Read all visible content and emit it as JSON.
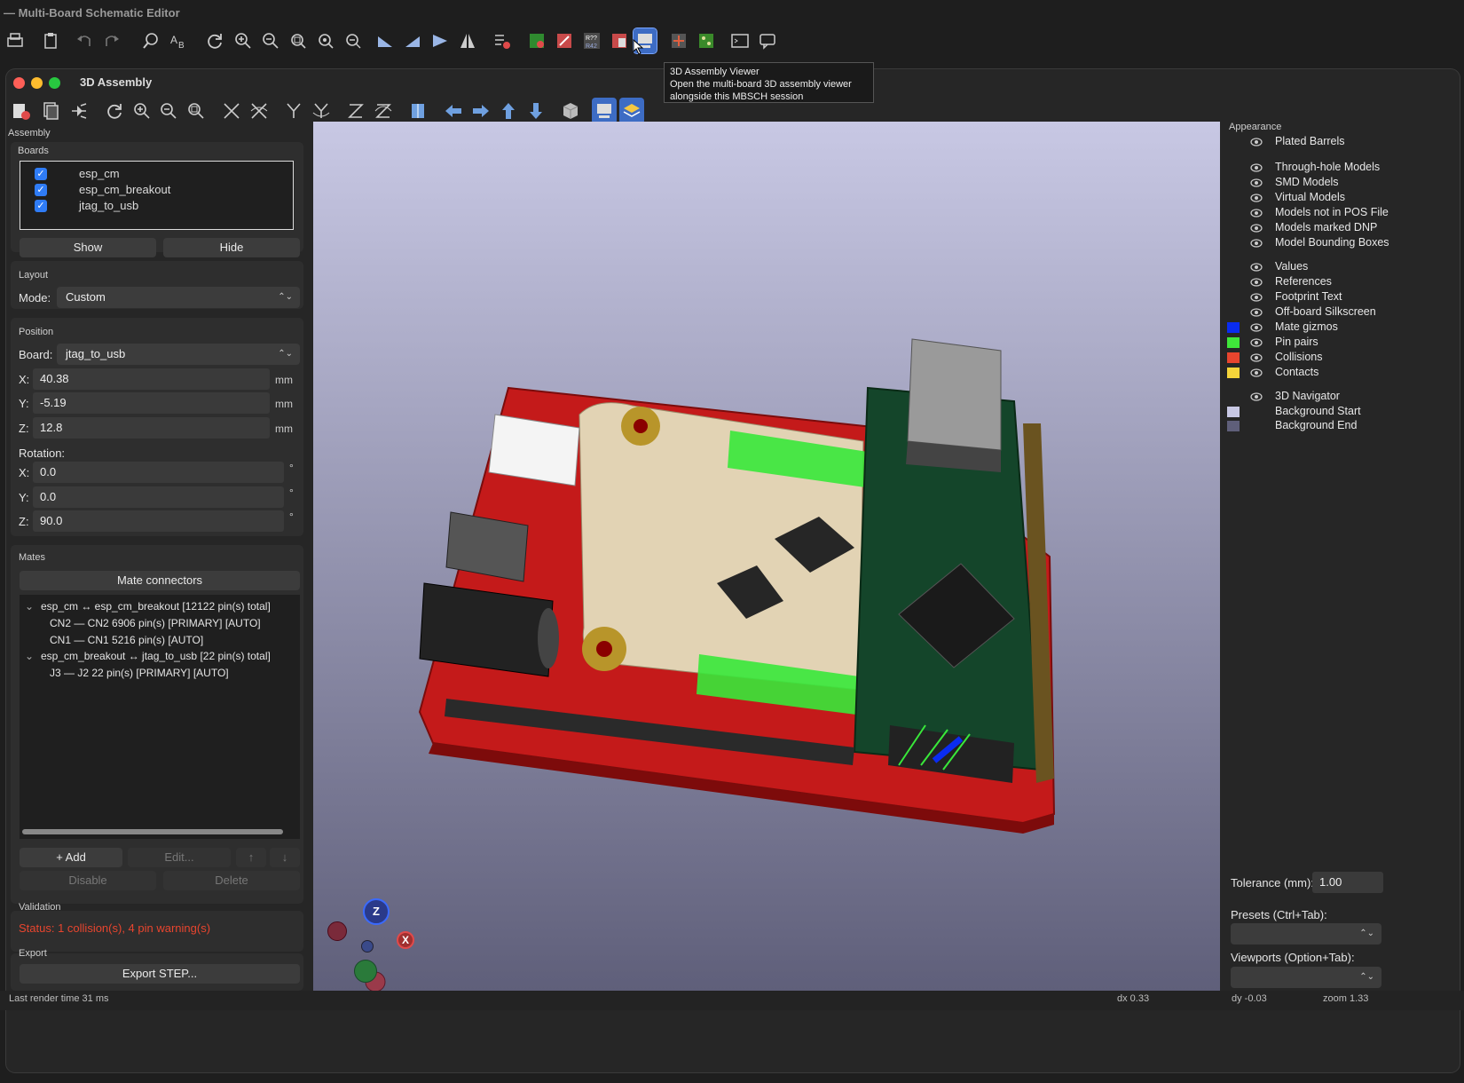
{
  "app_title": "— Multi-Board Schematic Editor",
  "tooltip": {
    "title": "3D Assembly Viewer",
    "line1": "Open the multi-board 3D assembly viewer",
    "line2": "alongside this MBSCH session"
  },
  "window": {
    "title": "3D Assembly"
  },
  "left": {
    "assembly_label": "Assembly",
    "boards_label": "Boards",
    "boards": [
      "esp_cm",
      "esp_cm_breakout",
      "jtag_to_usb"
    ],
    "show_label": "Show",
    "hide_label": "Hide",
    "layout_label": "Layout",
    "mode_label": "Mode:",
    "mode_value": "Custom",
    "position_label": "Position",
    "board_label": "Board:",
    "board_value": "jtag_to_usb",
    "x_label": "X:",
    "x_value": "40.38",
    "y_label": "Y:",
    "y_value": "-5.19",
    "z_label": "Z:",
    "z_value": "12.8",
    "unit_mm": "mm",
    "rotation_label": "Rotation:",
    "rx_value": "0.0",
    "ry_value": "0.0",
    "rz_value": "90.0",
    "unit_deg": "°",
    "mates_label": "Mates",
    "mate_connectors_label": "Mate connectors",
    "mates": {
      "g1": "esp_cm ↔ esp_cm_breakout   [12122 pin(s) total]",
      "g1a": "CN2 — CN2   6906 pin(s)   [PRIMARY] [AUTO]",
      "g1b": "CN1 — CN1   5216 pin(s)   [AUTO]",
      "g2": "esp_cm_breakout ↔ jtag_to_usb   [22 pin(s) total]",
      "g2a": "J3 — J2   22 pin(s)   [PRIMARY] [AUTO]"
    },
    "add_label": "+ Add",
    "edit_label": "Edit...",
    "up_label": "↑",
    "down_label": "↓",
    "disable_label": "Disable",
    "delete_label": "Delete",
    "validation_label": "Validation",
    "status_text": "Status: 1 collision(s), 4 pin warning(s)",
    "export_label": "Export",
    "export_step_label": "Export STEP..."
  },
  "right": {
    "appearance_label": "Appearance",
    "items": [
      {
        "label": "Plated Barrels"
      },
      {
        "label": "Through-hole Models"
      },
      {
        "label": "SMD Models"
      },
      {
        "label": "Virtual Models"
      },
      {
        "label": "Models not in POS File"
      },
      {
        "label": "Models marked DNP"
      },
      {
        "label": "Model Bounding Boxes"
      },
      {
        "label": "Values"
      },
      {
        "label": "References"
      },
      {
        "label": "Footprint Text"
      },
      {
        "label": "Off-board Silkscreen"
      },
      {
        "label": "Mate gizmos",
        "color": "#0a2cf0"
      },
      {
        "label": "Pin pairs",
        "color": "#3fe63a"
      },
      {
        "label": "Collisions",
        "color": "#e8452e"
      },
      {
        "label": "Contacts",
        "color": "#f5d43a"
      },
      {
        "label": "3D Navigator"
      },
      {
        "label": "Background Start",
        "color": "#c8c8e4"
      },
      {
        "label": "Background End",
        "color": "#5f5f7a"
      }
    ],
    "tolerance_label": "Tolerance (mm):",
    "tolerance_value": "1.00",
    "presets_label": "Presets (Ctrl+Tab):",
    "viewports_label": "Viewports (Option+Tab):"
  },
  "status": {
    "render_time": "Last render time 31 ms",
    "dx": "dx 0.33",
    "dy": "dy -0.03",
    "zoom": "zoom 1.33"
  },
  "navigator": {
    "z": "Z",
    "x": "X"
  }
}
